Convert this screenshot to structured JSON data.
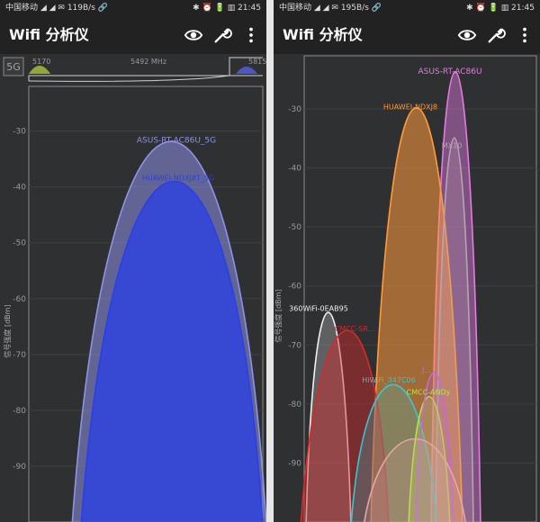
{
  "screens": [
    {
      "status_left": "中国移动 ◢ ◢ ✉ 119B/s 🔗",
      "status_right": "✱ ⏰ 🔋 ▥ 21:45",
      "title": "Wifi 分析仪",
      "band_button": "5G",
      "freq_labels": [
        "5170",
        "5492 MHz",
        "5815"
      ],
      "chart_data": {
        "type": "area",
        "ylabel": "信号强度 [dBm]",
        "yticks": [
          -30,
          -40,
          -50,
          -60,
          -70,
          -80,
          -90
        ],
        "ylim": [
          -100,
          -22
        ],
        "series": [
          {
            "name": "ASUS-RT-AC86U_5G",
            "peak": -33,
            "color": "#8c92e6"
          },
          {
            "name": "HUAWEI-NDXJ8T_5G",
            "peak": -40,
            "color": "#2a3fe8"
          }
        ]
      }
    },
    {
      "status_left": "中国移动 ◢ ◢ ✉ 195B/s 🔗",
      "status_right": "✱ ⏰ 🔋 ▥ 21:45",
      "title": "Wifi 分析仪",
      "chart_data": {
        "type": "area",
        "ylabel": "信号强度 [dBm]",
        "yticks": [
          -30,
          -40,
          -50,
          -60,
          -70,
          -80,
          -90
        ],
        "ylim": [
          -100,
          -21
        ],
        "series": [
          {
            "name": "ASUS-RT-AC86U",
            "peak": -25,
            "color": "#e37be0"
          },
          {
            "name": "HUAWEI-NDXJ8",
            "peak": -31,
            "color": "#ff9a3a"
          },
          {
            "name": "MX10",
            "peak": -36,
            "color": "#b8a3b5"
          },
          {
            "name": "360WiFi-0EAB95",
            "peak": -65,
            "color": "#f0f0f0"
          },
          {
            "name": "CMCC-SR...",
            "peak": -68,
            "color": "#d52a2a"
          },
          {
            "name": "HiWiFi_347C06",
            "peak": -77,
            "color": "#36c6d4"
          },
          {
            "name": "CMCC-ANDy",
            "peak": -79,
            "color": "#b7e24b"
          },
          {
            "name": "J...",
            "peak": -75,
            "color": "#c06ad8"
          },
          {
            "name": "",
            "peak": -86,
            "color": "#e6a6a6"
          }
        ]
      }
    }
  ]
}
